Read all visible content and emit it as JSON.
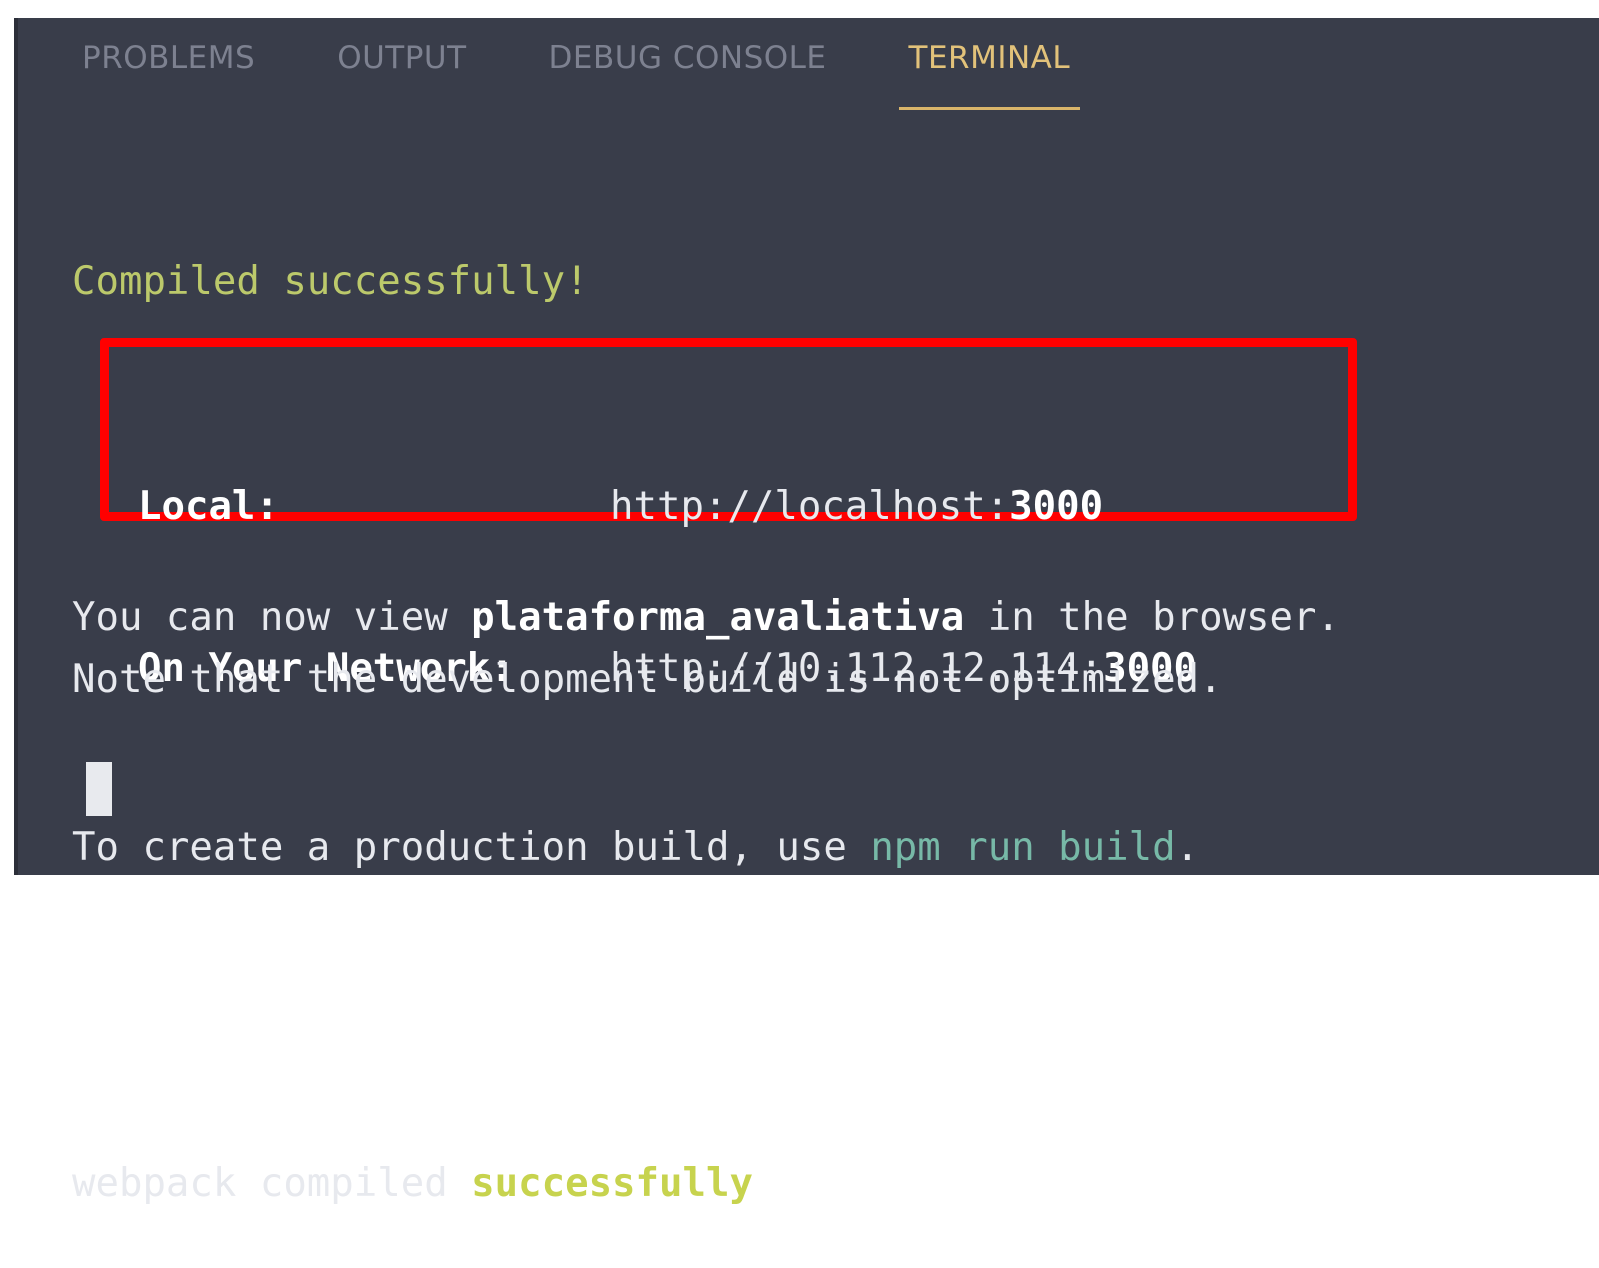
{
  "tabs": [
    {
      "label": "PROBLEMS",
      "active": false
    },
    {
      "label": "OUTPUT",
      "active": false
    },
    {
      "label": "DEBUG CONSOLE",
      "active": false
    },
    {
      "label": "TERMINAL",
      "active": true
    }
  ],
  "terminal": {
    "compiled": "Compiled successfully!",
    "view_prefix": "You can now view ",
    "app_name": "plataforma_avaliativa",
    "view_suffix": " in the browser.",
    "local_label": "Local:",
    "local_url_prefix": "http://localhost:",
    "local_port": "3000",
    "network_label": "On Your Network:",
    "network_url_prefix": "http://10.112.12.114:",
    "network_port": "3000",
    "note_line": "Note that the development build is not optimized.",
    "prod_prefix": "To create a production build, use ",
    "prod_command": "npm run build",
    "prod_suffix": ".",
    "webpack_prefix": "webpack compiled ",
    "webpack_status": "successfully"
  },
  "colors": {
    "background": "#393d4a",
    "active_tab": "#e2c27a",
    "success_green": "#bcc96b",
    "command_teal": "#77b9a7",
    "highlight_red": "#ff0000"
  }
}
